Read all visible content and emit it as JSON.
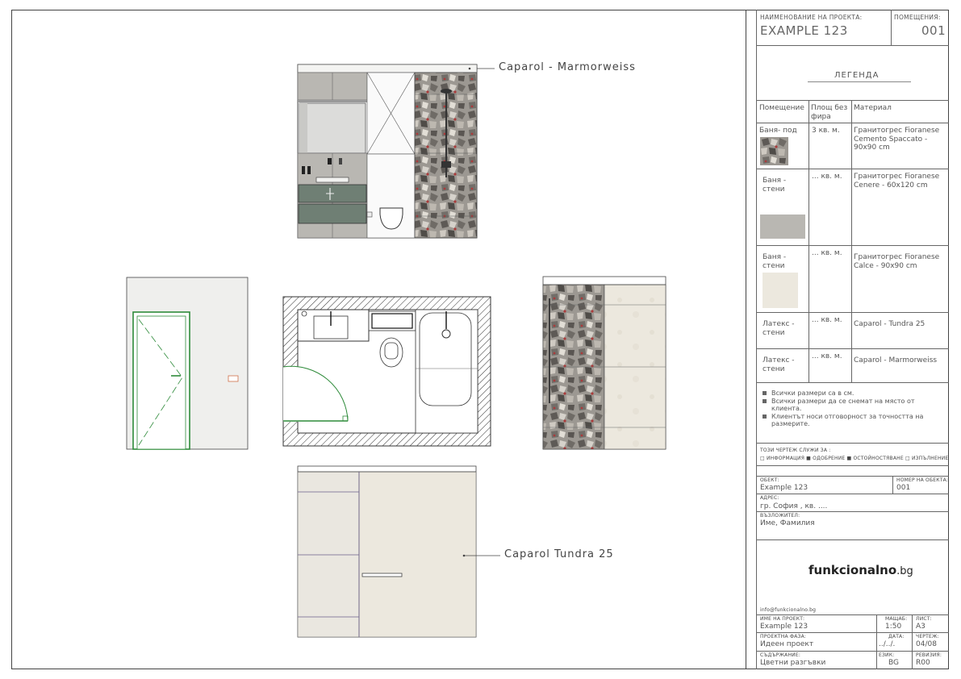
{
  "callouts": {
    "top": "Caparol - Marmorweiss",
    "bottom": "Caparol Tundra 25"
  },
  "title_block": {
    "project_name_label": "НАИМЕНОВАНИЕ НА ПРОЕКТА:",
    "project_name": "EXAMPLE 123",
    "room_label": "ПОМЕЩЕНИЯ:",
    "room_value": "001",
    "legend_title": "ЛЕГЕНДА",
    "legend_headers": {
      "room": "Помещение",
      "area": "Площ без фира",
      "material": "Материал"
    },
    "legend_rows": [
      {
        "room": "Баня- под",
        "area": "3 кв. м.",
        "material": "Гранитогрес Fioranese Cemento Spaccato - 90x90 cm",
        "swatch": "terrazzo"
      },
      {
        "room": "Баня - стени",
        "area": "... кв. м.",
        "material": "Гранитогрес Fioranese Cenere - 60x120 cm",
        "swatch": "grey"
      },
      {
        "room": "Баня - стени",
        "area": "... кв. м.",
        "material": "Гранитогрес Fioranese Calce - 90x90 cm",
        "swatch": "cream"
      },
      {
        "room": "Латекс - стени",
        "area": "... кв. м.",
        "material": "Caparol - Tundra 25",
        "swatch": ""
      },
      {
        "room": "Латекс - стени",
        "area": "... кв. м.",
        "material": "Caparol - Marmorweiss",
        "swatch": ""
      }
    ],
    "notes": [
      "Всички размери са в см.",
      "Всички размери да се снемат на място от клиента.",
      "Клиентът носи отговорност за точността на размерите."
    ],
    "purpose_label": "ТОЗИ ЧЕРТЕЖ СЛУЖИ ЗА :",
    "purpose_options": "□ ИНФОРМАЦИЯ ■ ОДОБРЕНИЕ ■ ОСТОЙНОСТЯВАНЕ □ ИЗПЪЛНЕНИЕ",
    "object_label": "ОБЕКТ:",
    "object_value": "Example 123",
    "object_no_label": "НОМЕР НА ОБЕКТА:",
    "object_no_value": "001",
    "address_label": "АДРЕС:",
    "address_value": "гр. София , кв. ....",
    "client_label": "ВЪЗЛОЖИТЕЛ:",
    "client_value": "Име, Фамилия",
    "brand_main": "funkcionalno",
    "brand_tld": ".bg",
    "email": "info@funkcionalno.bg",
    "proj_name_label": "ИМЕ НА ПРОЕКТ:",
    "proj_name_value": "Example 123",
    "scale_label": "МАЩАБ:",
    "scale_value": "1:50",
    "sheet_label": "ЛИСТ:",
    "sheet_value": "A3",
    "phase_label": "ПРОЕКТНА ФАЗА:",
    "phase_value": "Идеен проект",
    "date_label": "ДАТА:",
    "date_value": "../../.",
    "drawing_label": "ЧЕРТЕЖ:",
    "drawing_value": "04/08",
    "content_label": "СЪДЪРЖАНИЕ:",
    "content_value": "Цветни разгъвки",
    "lang_label": "ЕЗИК:",
    "lang_value": "BG",
    "rev_label": "РЕВИЗИЯ:",
    "rev_value": "R00"
  },
  "colors": {
    "line": "#444444",
    "terrazzo_base": "#8a8680",
    "cement_grey": "#b9b7b2",
    "cream": "#ece8de",
    "cabinet_green": "#6f7f74",
    "door_green": "#2e8b3a",
    "wall_light": "#efefed"
  }
}
